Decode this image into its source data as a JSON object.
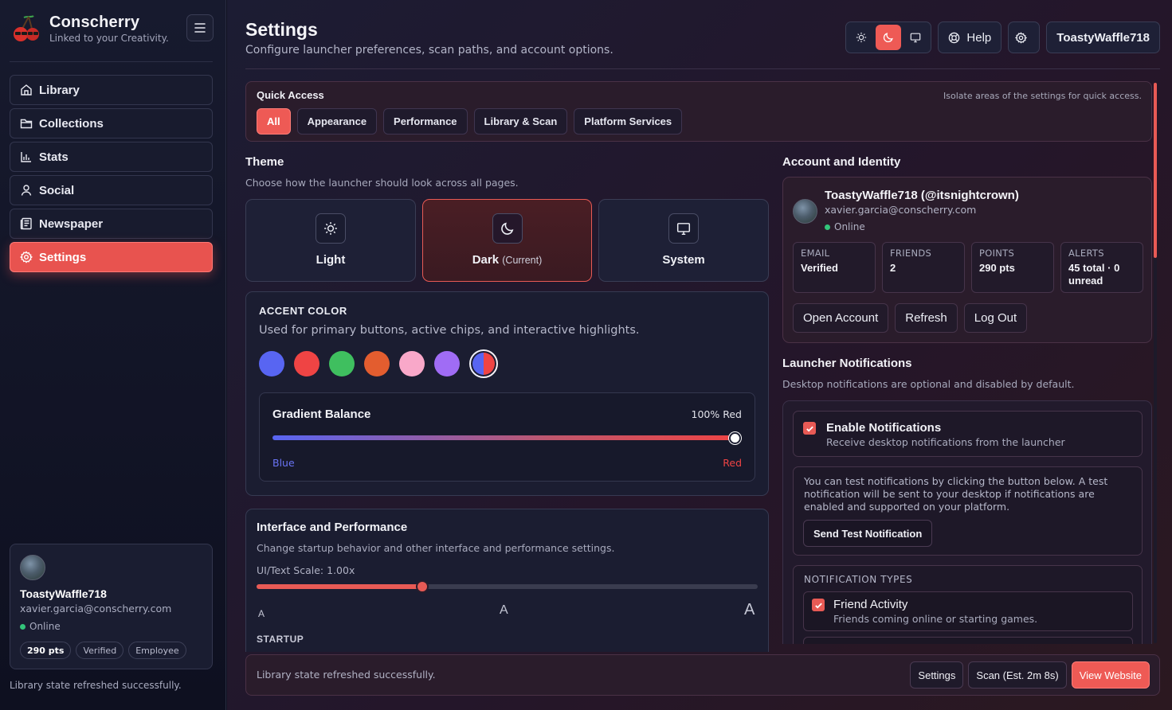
{
  "brand": {
    "name": "Conscherry",
    "tagline": "Linked to your Creativity."
  },
  "sidebar": {
    "items": [
      {
        "label": "Library",
        "icon": "home-icon",
        "active": false
      },
      {
        "label": "Collections",
        "icon": "folder-icon",
        "active": false
      },
      {
        "label": "Stats",
        "icon": "bar-chart-icon",
        "active": false
      },
      {
        "label": "Social",
        "icon": "user-icon",
        "active": false
      },
      {
        "label": "Newspaper",
        "icon": "newspaper-icon",
        "active": false
      },
      {
        "label": "Settings",
        "icon": "gear-icon",
        "active": true
      }
    ],
    "profile": {
      "name": "ToastyWaffle718",
      "email": "xavier.garcia@conscherry.com",
      "status": "Online",
      "badges": [
        "290 pts",
        "Verified",
        "Employee"
      ]
    },
    "status_text": "Library state refreshed successfully."
  },
  "header": {
    "title": "Settings",
    "subtitle": "Configure launcher preferences, scan paths, and account options.",
    "help_label": "Help",
    "user_label": "ToastyWaffle718",
    "theme_toggle_active": "dark"
  },
  "quick_access": {
    "title": "Quick Access",
    "hint": "Isolate areas of the settings for quick access.",
    "chips": [
      {
        "label": "All",
        "active": true
      },
      {
        "label": "Appearance",
        "active": false
      },
      {
        "label": "Performance",
        "active": false
      },
      {
        "label": "Library & Scan",
        "active": false
      },
      {
        "label": "Platform Services",
        "active": false
      }
    ]
  },
  "theme": {
    "title": "Theme",
    "subtitle": "Choose how the launcher should look across all pages.",
    "options": [
      {
        "label": "Light",
        "tag": "",
        "icon": "sun-icon"
      },
      {
        "label": "Dark",
        "tag": "(Current)",
        "icon": "moon-icon"
      },
      {
        "label": "System",
        "tag": "",
        "icon": "monitor-icon"
      }
    ]
  },
  "accent": {
    "title": "ACCENT COLOR",
    "subtitle": "Used for primary buttons, active chips, and interactive highlights.",
    "swatches": [
      "#5865f2",
      "#ef4444",
      "#3fbf5f",
      "#e35d2f",
      "#f9a8c9",
      "#a06cf5"
    ],
    "selected": "gradient",
    "gradient": {
      "title": "Gradient Balance",
      "value_label": "100% Red",
      "value": 1.0,
      "left_label": "Blue",
      "right_label": "Red",
      "left_color": "#5865f2",
      "right_color": "#ef4444"
    }
  },
  "interface": {
    "title": "Interface and Performance",
    "subtitle": "Change startup behavior and other interface and performance settings.",
    "scale_label": "UI/Text Scale: 1.00x",
    "scale_value": 0.33,
    "glyph": "A",
    "startup_label": "STARTUP"
  },
  "account": {
    "title": "Account and Identity",
    "name": "ToastyWaffle718 (@itsnightcrown)",
    "email": "xavier.garcia@conscherry.com",
    "status": "Online",
    "stats": [
      {
        "key": "EMAIL",
        "value": "Verified"
      },
      {
        "key": "FRIENDS",
        "value": "2"
      },
      {
        "key": "POINTS",
        "value": "290 pts"
      },
      {
        "key": "ALERTS",
        "value": "45 total · 0 unread"
      }
    ],
    "buttons": [
      "Open Account",
      "Refresh",
      "Log Out"
    ]
  },
  "notifications": {
    "title": "Launcher Notifications",
    "subtitle": "Desktop notifications are optional and disabled by default.",
    "enable_title": "Enable Notifications",
    "enable_sub": "Receive desktop notifications from the launcher",
    "enable_checked": true,
    "test_text": "You can test notifications by clicking the button below. A test notification will be sent to your desktop if notifications are enabled and supported on your platform.",
    "test_button": "Send Test Notification",
    "types_title": "NOTIFICATION TYPES",
    "types": [
      {
        "title": "Friend Activity",
        "sub": "Friends coming online or starting games.",
        "checked": true
      }
    ]
  },
  "footer": {
    "message": "Library state refreshed successfully.",
    "buttons": [
      "Settings",
      "Scan (Est. 2m 8s)",
      "View Website"
    ]
  }
}
